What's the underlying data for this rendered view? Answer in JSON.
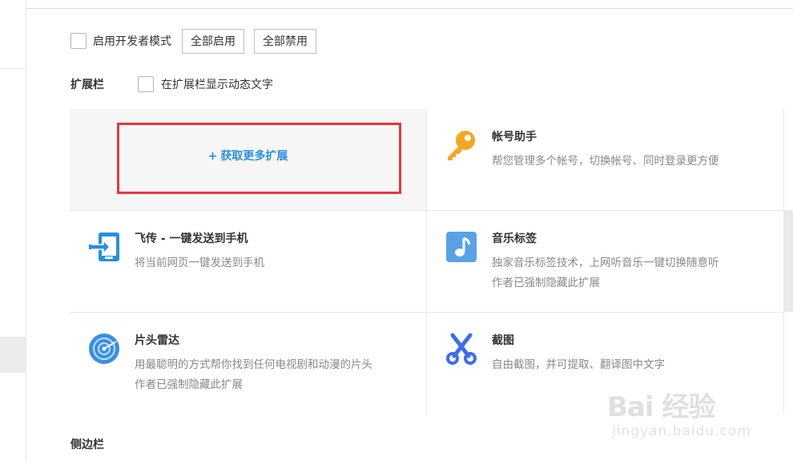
{
  "developer": {
    "mode_label": "启用开发者模式",
    "enable_all_label": "全部启用",
    "disable_all_label": "全部禁用"
  },
  "extension_bar": {
    "title": "扩展栏",
    "show_text_label": "在扩展栏显示动态文字",
    "get_more_label": "获取更多扩展",
    "items": [
      {
        "name": "帐号助手",
        "desc": "帮您管理多个帐号，切换帐号、同时登录更方便",
        "note": "",
        "icon": "key-icon",
        "color": "#f5a623"
      },
      {
        "name": "飞传 - 一键发送到手机",
        "desc": "将当前网页一键发送到手机",
        "note": "",
        "icon": "phone-send-icon",
        "color": "#2a8ee0"
      },
      {
        "name": "音乐标签",
        "desc": "独家音乐标签技术，上网听音乐一键切换随意听",
        "note": "作者已强制隐藏此扩展",
        "icon": "music-note-icon",
        "color": "#5aa2e6"
      },
      {
        "name": "片头雷达",
        "desc": "用最聪明的方式帮你找到任何电视剧和动漫的片头",
        "note": "作者已强制隐藏此扩展",
        "icon": "radar-icon",
        "color": "#3b8fe0"
      },
      {
        "name": "截图",
        "desc": "自由截图，并可提取、翻译图中文字",
        "note": "",
        "icon": "scissors-icon",
        "color": "#3d6cf0"
      }
    ]
  },
  "sidebar": {
    "title": "侧边栏"
  },
  "watermark": {
    "main": "Bai 经验",
    "sub": "jingyan.baidu.com"
  }
}
